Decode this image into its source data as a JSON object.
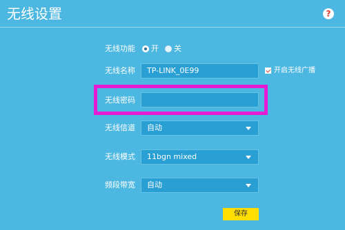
{
  "page": {
    "title": "无线设置",
    "help_icon": "?"
  },
  "form": {
    "wireless_function": {
      "label": "无线功能",
      "options": [
        {
          "label": "开",
          "selected": true
        },
        {
          "label": "关",
          "selected": false
        }
      ]
    },
    "wireless_name": {
      "label": "无线名称",
      "value": "TP-LINK_0E99",
      "broadcast_label": "开启无线广播",
      "broadcast_checked": true
    },
    "wireless_password": {
      "label": "无线密码",
      "value": ""
    },
    "wireless_channel": {
      "label": "无线信道",
      "value": "自动"
    },
    "wireless_mode": {
      "label": "无线模式",
      "value": "11bgn mixed"
    },
    "bandwidth": {
      "label": "频段带宽",
      "value": "自动"
    },
    "save_label": "保存"
  },
  "colors": {
    "background": "#4cb7e0",
    "field": "#2a9fd4",
    "highlight": "#e81bd4",
    "save_button": "#ffde00"
  }
}
